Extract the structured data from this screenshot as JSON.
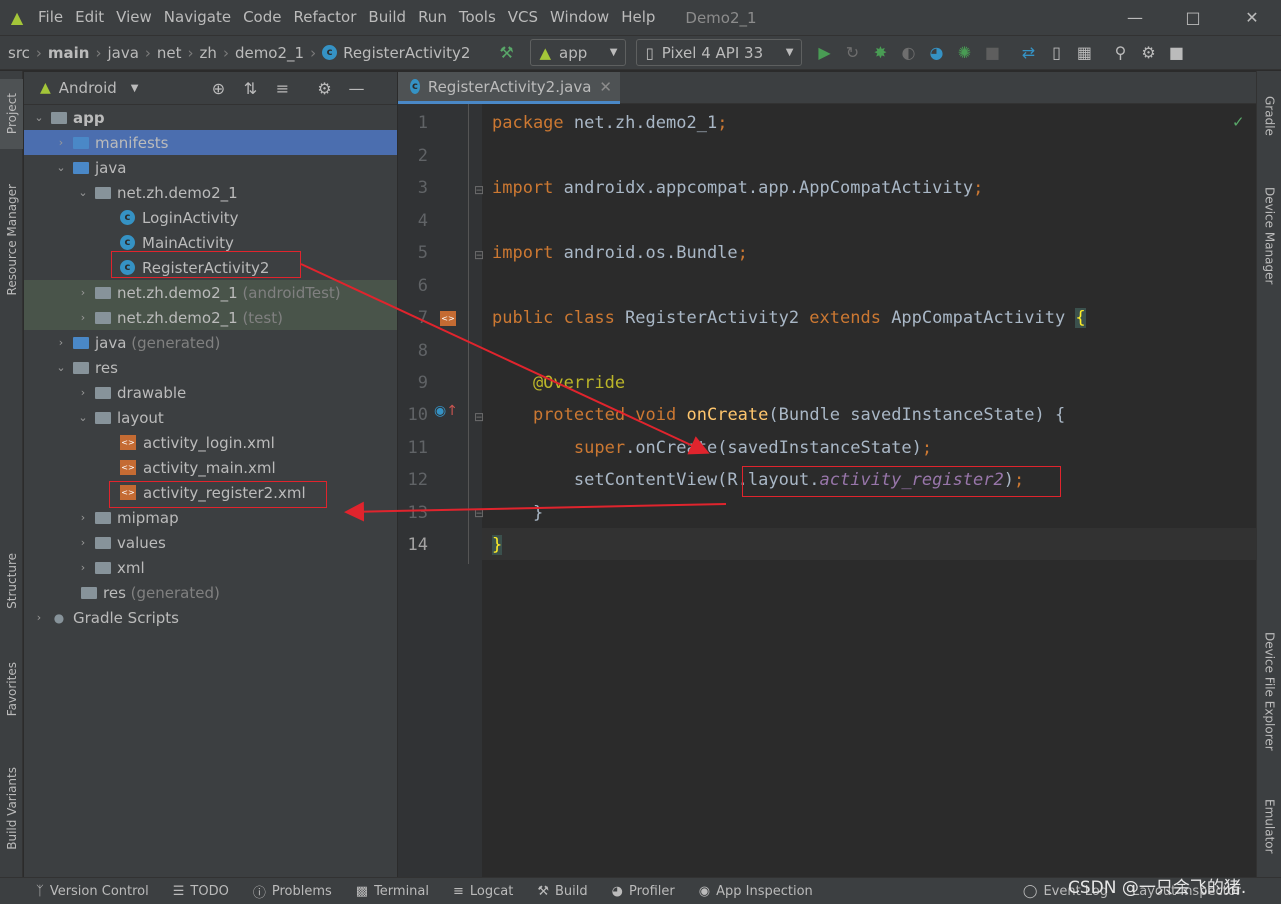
{
  "menu": {
    "items": [
      "File",
      "Edit",
      "View",
      "Navigate",
      "Code",
      "Refactor",
      "Build",
      "Run",
      "Tools",
      "VCS",
      "Window",
      "Help"
    ],
    "project_title": "Demo2_1"
  },
  "nav": {
    "crumbs": [
      "src",
      "main",
      "java",
      "net",
      "zh",
      "demo2_1",
      "RegisterActivity2"
    ],
    "run_config": "app",
    "device": "Pixel 4 API 33"
  },
  "left_tabs": [
    "Project",
    "Resource Manager",
    "Structure",
    "Favorites",
    "Build Variants"
  ],
  "right_tabs": [
    "Gradle",
    "Device Manager",
    "Device File Explorer",
    "Emulator"
  ],
  "project": {
    "view": "Android",
    "tree": [
      {
        "label": "app",
        "sub": ""
      },
      {
        "label": "manifests",
        "sub": ""
      },
      {
        "label": "java",
        "sub": ""
      },
      {
        "label": "net.zh.demo2_1",
        "sub": ""
      },
      {
        "label": "LoginActivity",
        "sub": ""
      },
      {
        "label": "MainActivity",
        "sub": ""
      },
      {
        "label": "RegisterActivity2",
        "sub": ""
      },
      {
        "label": "net.zh.demo2_1",
        "sub": "(androidTest)"
      },
      {
        "label": "net.zh.demo2_1",
        "sub": "(test)"
      },
      {
        "label": "java",
        "sub": "(generated)"
      },
      {
        "label": "res",
        "sub": ""
      },
      {
        "label": "drawable",
        "sub": ""
      },
      {
        "label": "layout",
        "sub": ""
      },
      {
        "label": "activity_login.xml",
        "sub": ""
      },
      {
        "label": "activity_main.xml",
        "sub": ""
      },
      {
        "label": "activity_register2.xml",
        "sub": ""
      },
      {
        "label": "mipmap",
        "sub": ""
      },
      {
        "label": "values",
        "sub": ""
      },
      {
        "label": "xml",
        "sub": ""
      },
      {
        "label": "res",
        "sub": "(generated)"
      },
      {
        "label": "Gradle Scripts",
        "sub": ""
      }
    ]
  },
  "editor": {
    "tab": "RegisterActivity2.java",
    "line_numbers": [
      "1",
      "2",
      "3",
      "4",
      "5",
      "6",
      "7",
      "8",
      "9",
      "10",
      "11",
      "12",
      "13",
      "14"
    ]
  },
  "status": {
    "tools": [
      "Version Control",
      "TODO",
      "Problems",
      "Terminal",
      "Logcat",
      "Build",
      "Profiler",
      "App Inspection"
    ],
    "right": [
      "Event Log",
      "Layout Inspector"
    ],
    "watermark": "CSDN @一只会飞的猪."
  }
}
